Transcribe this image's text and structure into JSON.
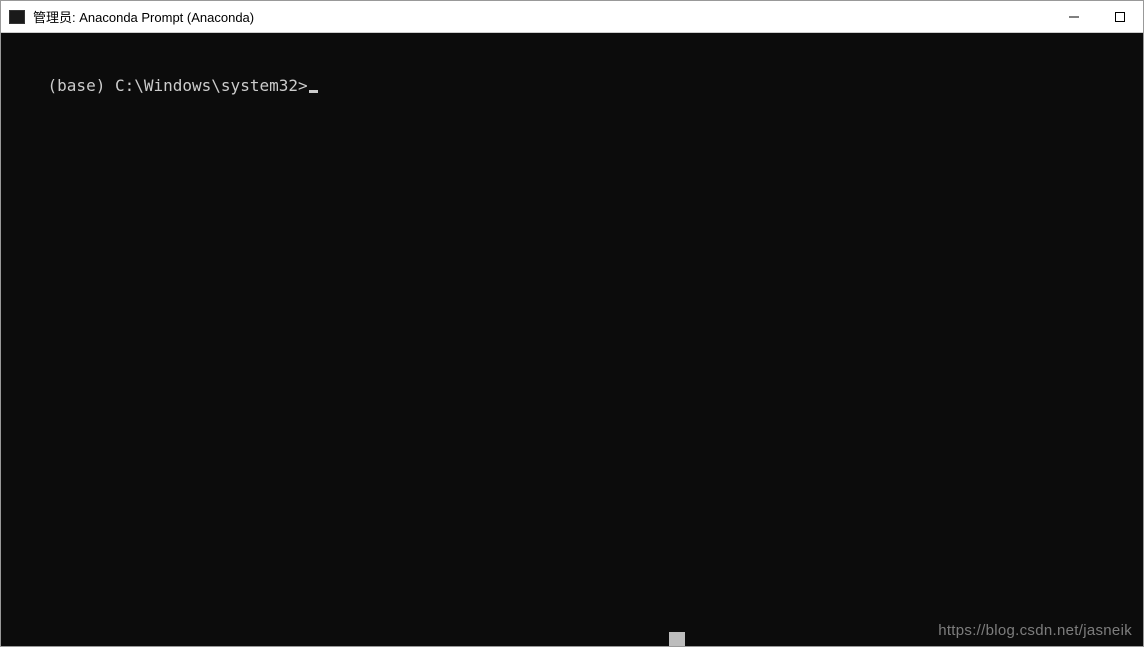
{
  "titlebar": {
    "title": "管理员: Anaconda Prompt (Anaconda)"
  },
  "terminal": {
    "prompt": "(base) C:\\Windows\\system32>"
  },
  "watermark": {
    "text": "https://blog.csdn.net/jasneik"
  }
}
